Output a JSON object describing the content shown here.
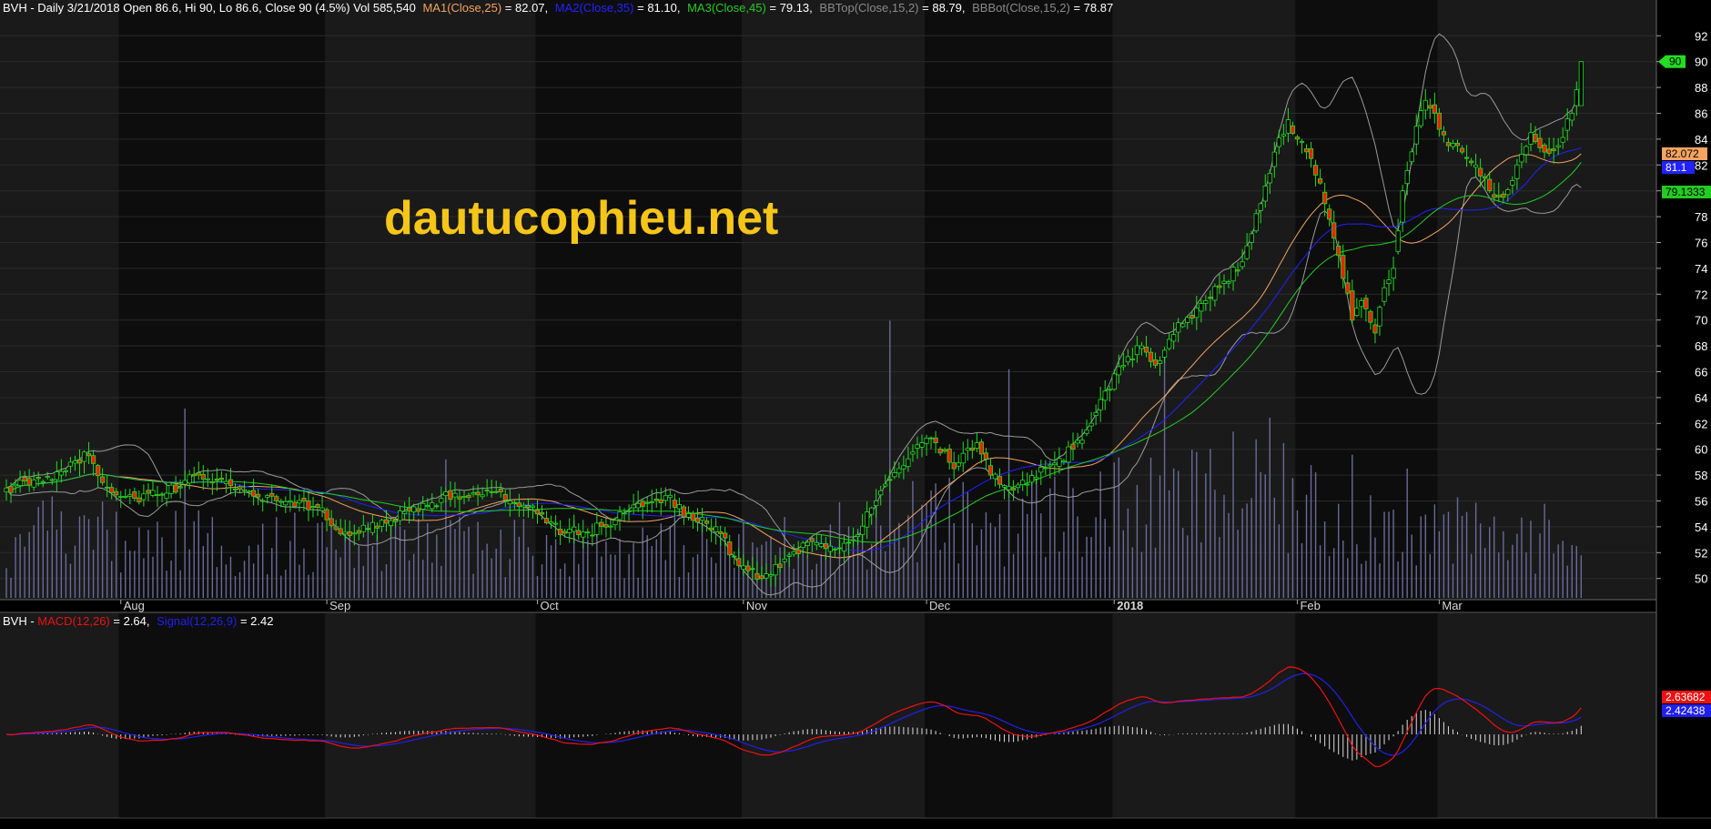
{
  "header": {
    "prefix": "BVH - Daily 3/21/2018 Open 86.6, Hi 90, Lo 86.6, Close 90 (4.5%) Vol 585,540",
    "ma1_label": "MA1(Close,25)",
    "ma1_value": " = 82.07,",
    "ma2_label": "MA2(Close,35)",
    "ma2_value": " = 81.10,",
    "ma3_label": "MA3(Close,45)",
    "ma3_value": " = 79.13,",
    "bbtop_label": "BBTop(Close,15,2)",
    "bbtop_value": " = 88.79,",
    "bbbot_label": "BBBot(Close,15,2)",
    "bbbot_value": " = 78.87"
  },
  "macd_header": {
    "prefix": "BVH - ",
    "macd_label": "MACD(12,26)",
    "macd_value": " = 2.64,",
    "signal_label": "Signal(12,26,9)",
    "signal_value": " = 2.42"
  },
  "watermark": "dautucophieu.net",
  "colors": {
    "up": "#22dd22",
    "down": "#ee2200",
    "ma1": "#f4a460",
    "ma2": "#2222ff",
    "ma3": "#22cc22",
    "bb": "#9a9a9a",
    "volume": "#6a6a9a",
    "macd": "#ee1111",
    "signal": "#2020ee",
    "hist": "#dddddd",
    "band_light": "#1a1a1a",
    "band_dark": "#0d0d0d"
  },
  "chart_data": [
    {
      "type": "candlestick",
      "title": "BVH - Daily",
      "ylim": [
        48.5,
        93.5
      ],
      "yticks": [
        "50",
        "52",
        "54",
        "56",
        "58",
        "60",
        "62",
        "64",
        "66",
        "68",
        "70",
        "72",
        "74",
        "76",
        "78",
        "80",
        "82",
        "84",
        "86",
        "88",
        "90",
        "92"
      ],
      "month_labels": [
        {
          "label": "Aug",
          "index": 25
        },
        {
          "label": "Sep",
          "index": 70
        },
        {
          "label": "Oct",
          "index": 116
        },
        {
          "label": "Nov",
          "index": 161
        },
        {
          "label": "Dec",
          "index": 201
        },
        {
          "label": "2018",
          "index": 242
        },
        {
          "label": "Feb",
          "index": 282
        },
        {
          "label": "Mar",
          "index": 313
        }
      ],
      "last_value_tags": [
        {
          "name": "Close",
          "value": "90",
          "color": "#22dd22",
          "text_color": "#000000",
          "price": 90
        },
        {
          "name": "MA1",
          "value": "82.072",
          "color": "#f4a460",
          "text_color": "#000000",
          "price": 82.07
        },
        {
          "name": "MA2",
          "value": "81.1",
          "color": "#2222ff",
          "text_color": "#ffffff",
          "price": 81.1
        },
        {
          "name": "MA3",
          "value": "79.1333",
          "color": "#22cc22",
          "text_color": "#000000",
          "price": 79.13
        }
      ],
      "close_anchors": [
        [
          0,
          57.0
        ],
        [
          8,
          57.5
        ],
        [
          14,
          59.0
        ],
        [
          18,
          59.5
        ],
        [
          22,
          57.0
        ],
        [
          28,
          56.2
        ],
        [
          35,
          56.6
        ],
        [
          42,
          58.0
        ],
        [
          48,
          57.5
        ],
        [
          55,
          56.3
        ],
        [
          62,
          56.0
        ],
        [
          68,
          55.5
        ],
        [
          72,
          53.8
        ],
        [
          77,
          53.5
        ],
        [
          82,
          54.5
        ],
        [
          90,
          55.2
        ],
        [
          95,
          56.2
        ],
        [
          105,
          56.8
        ],
        [
          110,
          56.0
        ],
        [
          116,
          55.0
        ],
        [
          122,
          53.5
        ],
        [
          127,
          53.6
        ],
        [
          133,
          54.5
        ],
        [
          138,
          55.8
        ],
        [
          144,
          56.4
        ],
        [
          150,
          54.5
        ],
        [
          155,
          54.0
        ],
        [
          160,
          51.0
        ],
        [
          165,
          50.0
        ],
        [
          170,
          51.5
        ],
        [
          175,
          52.8
        ],
        [
          180,
          52.5
        ],
        [
          185,
          53.0
        ],
        [
          190,
          56.0
        ],
        [
          195,
          58.5
        ],
        [
          200,
          60.5
        ],
        [
          203,
          60.5
        ],
        [
          207,
          58.5
        ],
        [
          212,
          60.5
        ],
        [
          215,
          58.0
        ],
        [
          218,
          57.2
        ],
        [
          223,
          57.3
        ],
        [
          228,
          58.8
        ],
        [
          233,
          60.0
        ],
        [
          236,
          61.5
        ],
        [
          240,
          64.5
        ],
        [
          244,
          66.5
        ],
        [
          248,
          68.0
        ],
        [
          251,
          66.5
        ],
        [
          254,
          68.5
        ],
        [
          258,
          70.2
        ],
        [
          262,
          71.5
        ],
        [
          266,
          73.0
        ],
        [
          270,
          74.5
        ],
        [
          274,
          79.0
        ],
        [
          277,
          83.0
        ],
        [
          280,
          85.5
        ],
        [
          282,
          84.0
        ],
        [
          285,
          82.5
        ],
        [
          288,
          79.0
        ],
        [
          291,
          75.0
        ],
        [
          294,
          70.0
        ],
        [
          296,
          71.5
        ],
        [
          299,
          69.0
        ],
        [
          301,
          72.5
        ],
        [
          303,
          74.0
        ],
        [
          305,
          80.0
        ],
        [
          308,
          85.0
        ],
        [
          310,
          87.0
        ],
        [
          312,
          86.0
        ],
        [
          315,
          83.5
        ],
        [
          318,
          83.0
        ],
        [
          321,
          82.0
        ],
        [
          324,
          80.0
        ],
        [
          327,
          79.5
        ],
        [
          330,
          82.0
        ],
        [
          333,
          84.5
        ],
        [
          336,
          83.0
        ],
        [
          339,
          83.5
        ],
        [
          342,
          86.0
        ],
        [
          344,
          90.0
        ]
      ],
      "volume_anchors": [
        [
          0,
          220
        ],
        [
          10,
          310
        ],
        [
          20,
          300
        ],
        [
          30,
          240
        ],
        [
          40,
          280
        ],
        [
          50,
          230
        ],
        [
          60,
          260
        ],
        [
          70,
          250
        ],
        [
          80,
          230
        ],
        [
          90,
          260
        ],
        [
          100,
          240
        ],
        [
          110,
          250
        ],
        [
          120,
          260
        ],
        [
          130,
          230
        ],
        [
          140,
          250
        ],
        [
          150,
          240
        ],
        [
          160,
          230
        ],
        [
          170,
          260
        ],
        [
          180,
          290
        ],
        [
          190,
          340
        ],
        [
          200,
          370
        ],
        [
          210,
          360
        ],
        [
          220,
          380
        ],
        [
          230,
          420
        ],
        [
          240,
          440
        ],
        [
          250,
          420
        ],
        [
          260,
          470
        ],
        [
          270,
          480
        ],
        [
          280,
          460
        ],
        [
          290,
          380
        ],
        [
          300,
          360
        ],
        [
          310,
          330
        ],
        [
          320,
          290
        ],
        [
          330,
          280
        ],
        [
          340,
          290
        ],
        [
          344,
          320
        ]
      ],
      "volume_spikes": [
        [
          39,
          820
        ],
        [
          96,
          600
        ],
        [
          193,
          1200
        ],
        [
          219,
          990
        ],
        [
          253,
          1050
        ],
        [
          268,
          720
        ],
        [
          276,
          780
        ],
        [
          294,
          620
        ],
        [
          306,
          560
        ]
      ],
      "volume_max": 1300
    },
    {
      "type": "macd",
      "ylim": [
        -5,
        7.5
      ],
      "macd_tag": "2.63682",
      "signal_tag": "2.42438",
      "macd_value": 2.64,
      "signal_value": 2.42
    }
  ]
}
